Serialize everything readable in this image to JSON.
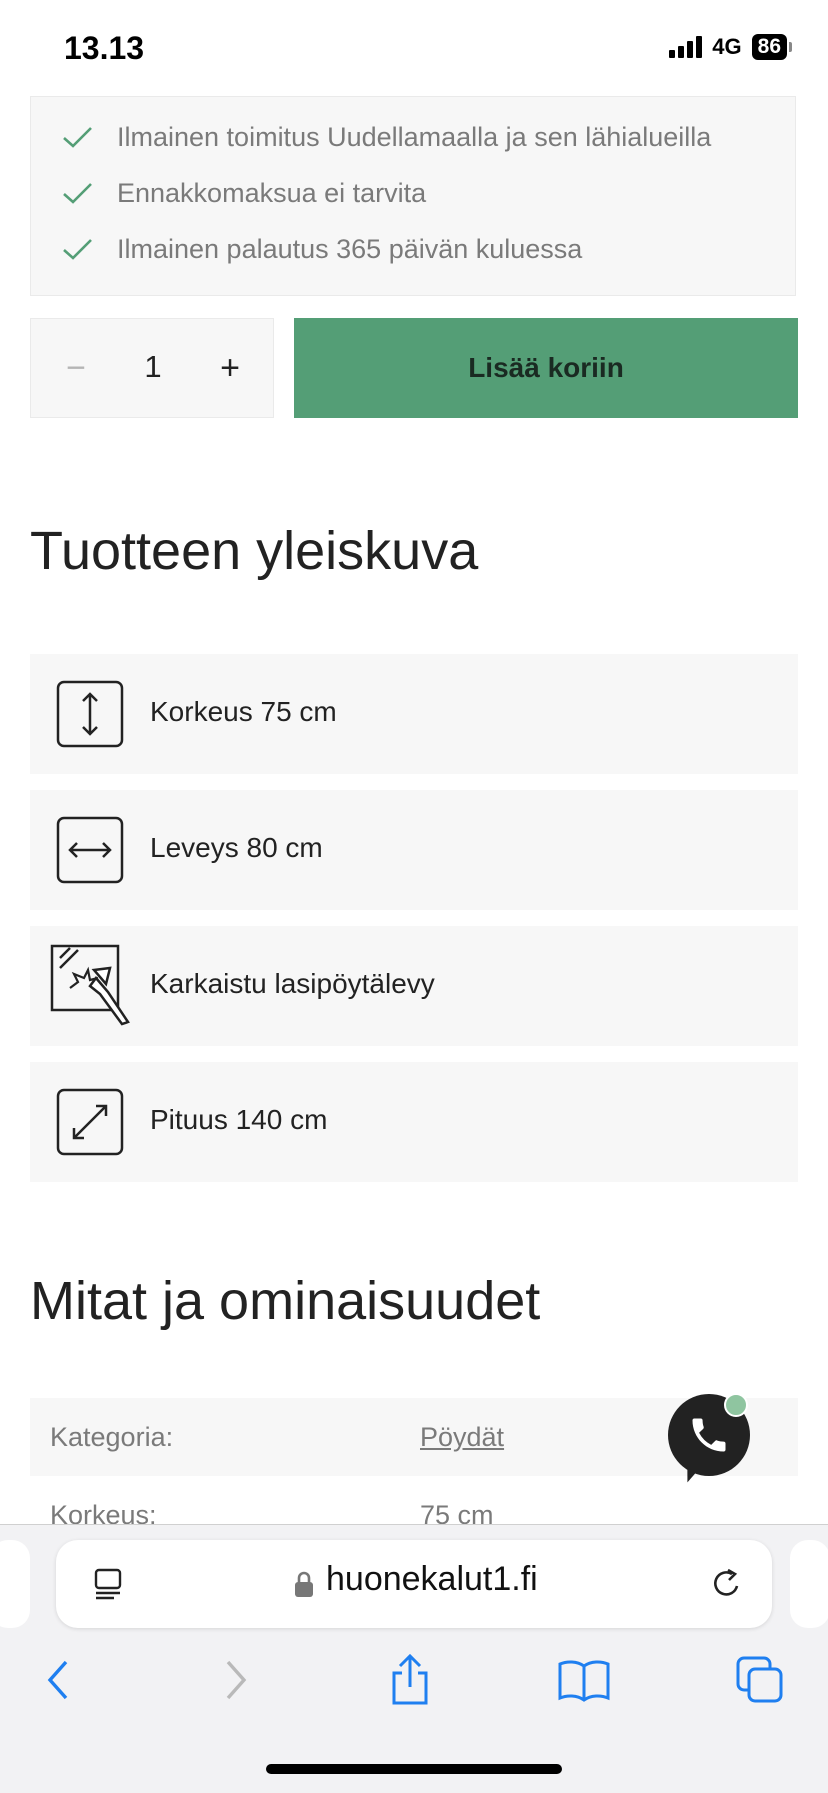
{
  "status_bar": {
    "time": "13.13",
    "network": "4G",
    "battery": "86"
  },
  "benefits": [
    "Ilmainen toimitus Uudellamaalla ja sen lähialueilla",
    "Ennakkomaksua ei tarvita",
    "Ilmainen palautus 365 päivän kuluessa"
  ],
  "quantity": {
    "minus": "−",
    "value": "1",
    "plus": "+"
  },
  "add_to_cart": "Lisää koriin",
  "overview": {
    "title": "Tuotteen yleiskuva",
    "features": [
      {
        "icon": "height-icon",
        "label": "Korkeus 75 cm"
      },
      {
        "icon": "width-icon",
        "label": "Leveys 80 cm"
      },
      {
        "icon": "tempered-glass-icon",
        "label": "Karkaistu lasipöytälevy"
      },
      {
        "icon": "length-icon",
        "label": "Pituus 140 cm"
      }
    ]
  },
  "specs": {
    "title": "Mitat ja ominaisuudet",
    "rows": [
      {
        "key": "Kategoria:",
        "value": "Pöydät"
      },
      {
        "key": "Korkeus:",
        "value": "75 cm"
      }
    ]
  },
  "browser": {
    "url": "huonekalut1.fi"
  },
  "colors": {
    "accent": "#549e76",
    "panel": "#f7f7f7",
    "ios_blue": "#1f7ff0"
  }
}
